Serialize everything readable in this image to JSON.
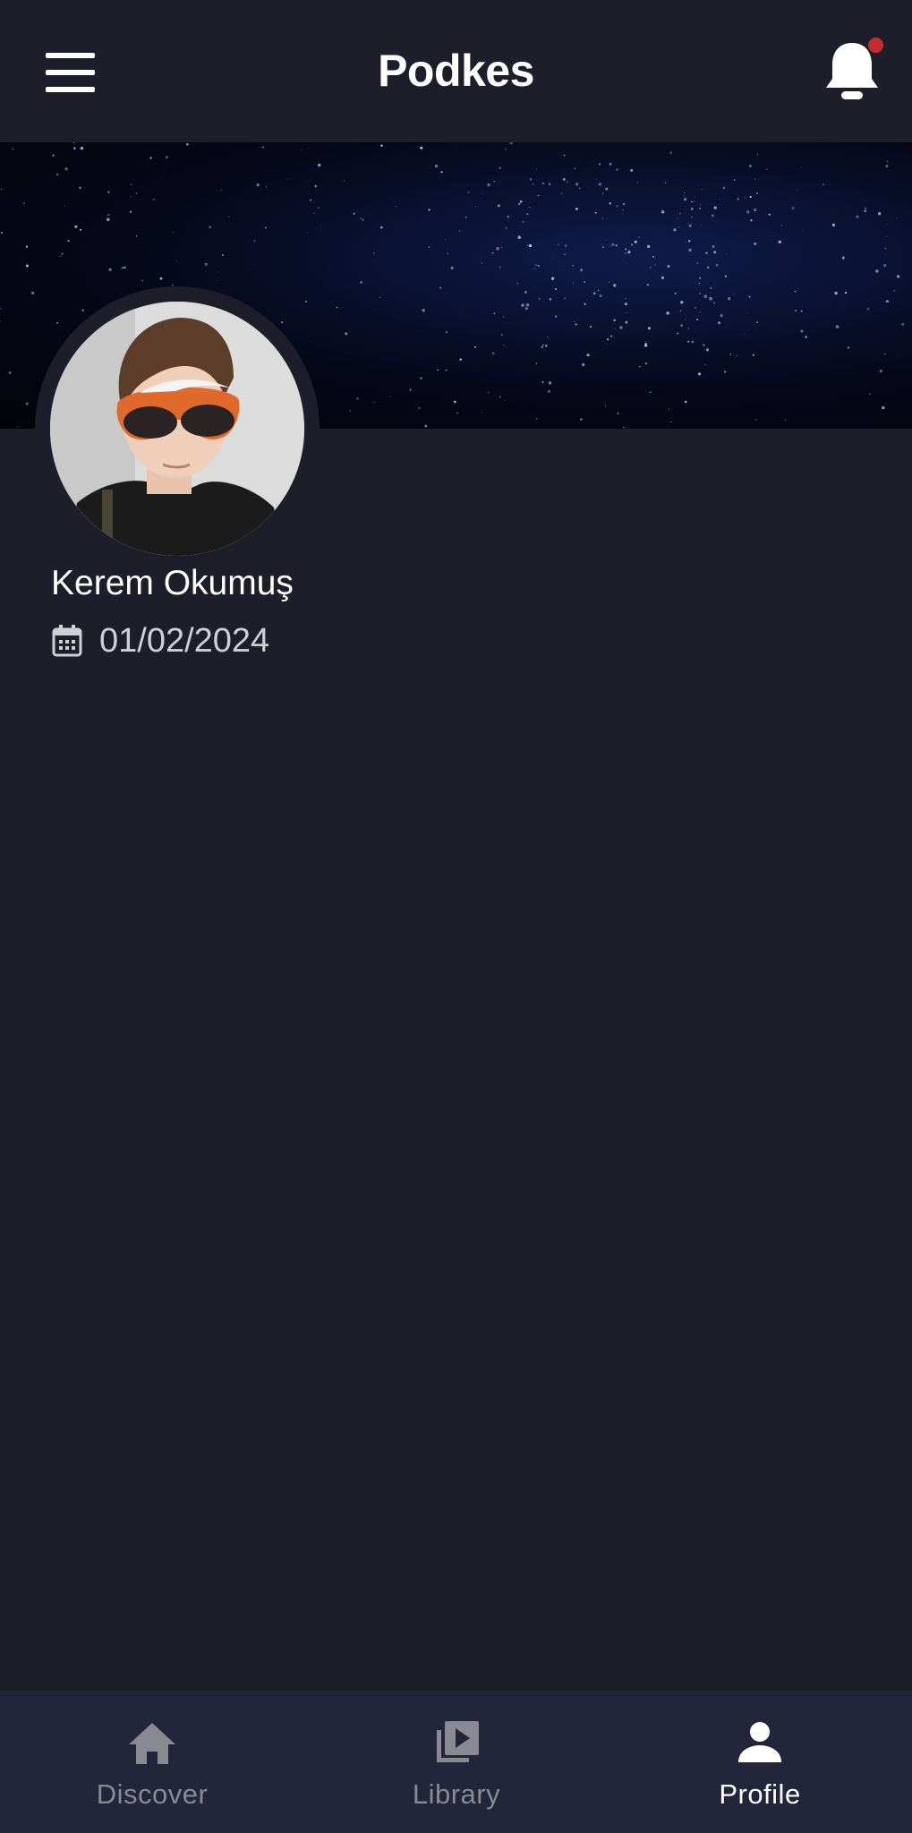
{
  "header": {
    "title": "Podkes",
    "menu_icon": "hamburger-menu-icon",
    "notification_icon": "bell-icon",
    "notification_dot_color": "#c62d2a"
  },
  "profile": {
    "name": "Kerem Okumuş",
    "date": "01/02/2024",
    "date_icon": "calendar-icon"
  },
  "colors": {
    "background": "#1e1d2a",
    "nav_background": "#23253a",
    "active": "#ffffff",
    "inactive": "#8a8a94"
  },
  "nav": {
    "items": [
      {
        "label": "Discover",
        "icon": "home-icon",
        "active": false
      },
      {
        "label": "Library",
        "icon": "video-library-icon",
        "active": false
      },
      {
        "label": "Profile",
        "icon": "person-icon",
        "active": true
      }
    ]
  }
}
